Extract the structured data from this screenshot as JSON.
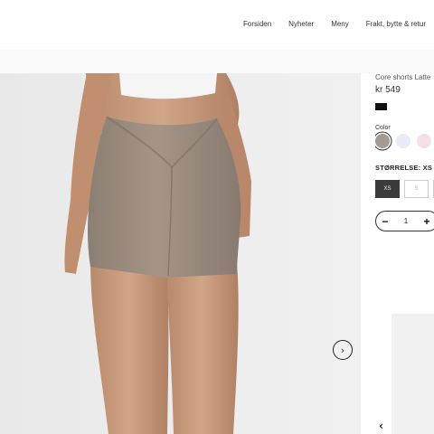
{
  "header": {
    "nav": [
      "Forsiden",
      "Nyheter",
      "Meny",
      "Frakt, bytte & retur"
    ]
  },
  "product": {
    "title": "Core shorts Latte",
    "price": "kr 549",
    "badge": "",
    "image_alt": "Core shorts Latte",
    "color_label": "Color",
    "colors": [
      "#a49a91",
      "#e6edf7",
      "#f6dee6",
      "#111111"
    ],
    "selected_color_index": 0,
    "size_label": "STØRRELSE: XS",
    "sizes": [
      "XS",
      "S",
      ""
    ],
    "selected_size": "XS",
    "quantity": "1"
  },
  "controls": {
    "next_icon": "chevron-right-icon",
    "prev_icon": "chevron-left-icon",
    "minus_icon": "minus-icon",
    "plus_icon": "plus-icon"
  }
}
